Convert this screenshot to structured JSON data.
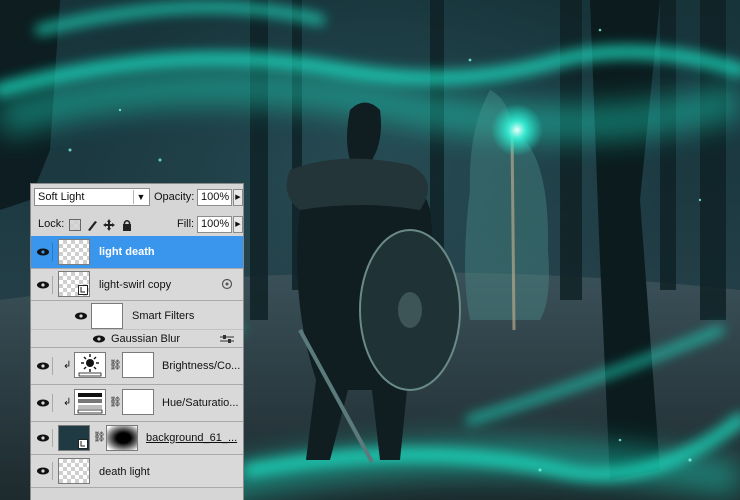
{
  "layers_panel": {
    "blend_mode": "Soft Light",
    "opacity_label": "Opacity:",
    "opacity_value": "100%",
    "lock_label": "Lock:",
    "fill_label": "Fill:",
    "fill_value": "100%",
    "layers": [
      {
        "name": "light death",
        "selected": true,
        "thumb": "transparent"
      },
      {
        "name": "light-swirl copy",
        "thumb": "smart-object",
        "badge": "smart-filter-icon"
      },
      {
        "name": "Smart Filters",
        "thumb": "white-mask",
        "sub": true
      },
      {
        "name": "Gaussian Blur",
        "sub": true,
        "filter": true
      },
      {
        "name": "Brightness/Co...",
        "thumb": "brightness-contrast-icon",
        "mask": "white",
        "clipped": true
      },
      {
        "name": "Hue/Saturatio...",
        "thumb": "hue-saturation-icon",
        "mask": "white",
        "clipped": true
      },
      {
        "name": "background_61_...",
        "thumb": "smart-object-dark",
        "mask": "vignette"
      },
      {
        "name": "death light"
      }
    ]
  },
  "colors": {
    "selection": "#3a96ec",
    "panel_bg": "#d6d6d6",
    "glow": "#1ee6c8"
  }
}
